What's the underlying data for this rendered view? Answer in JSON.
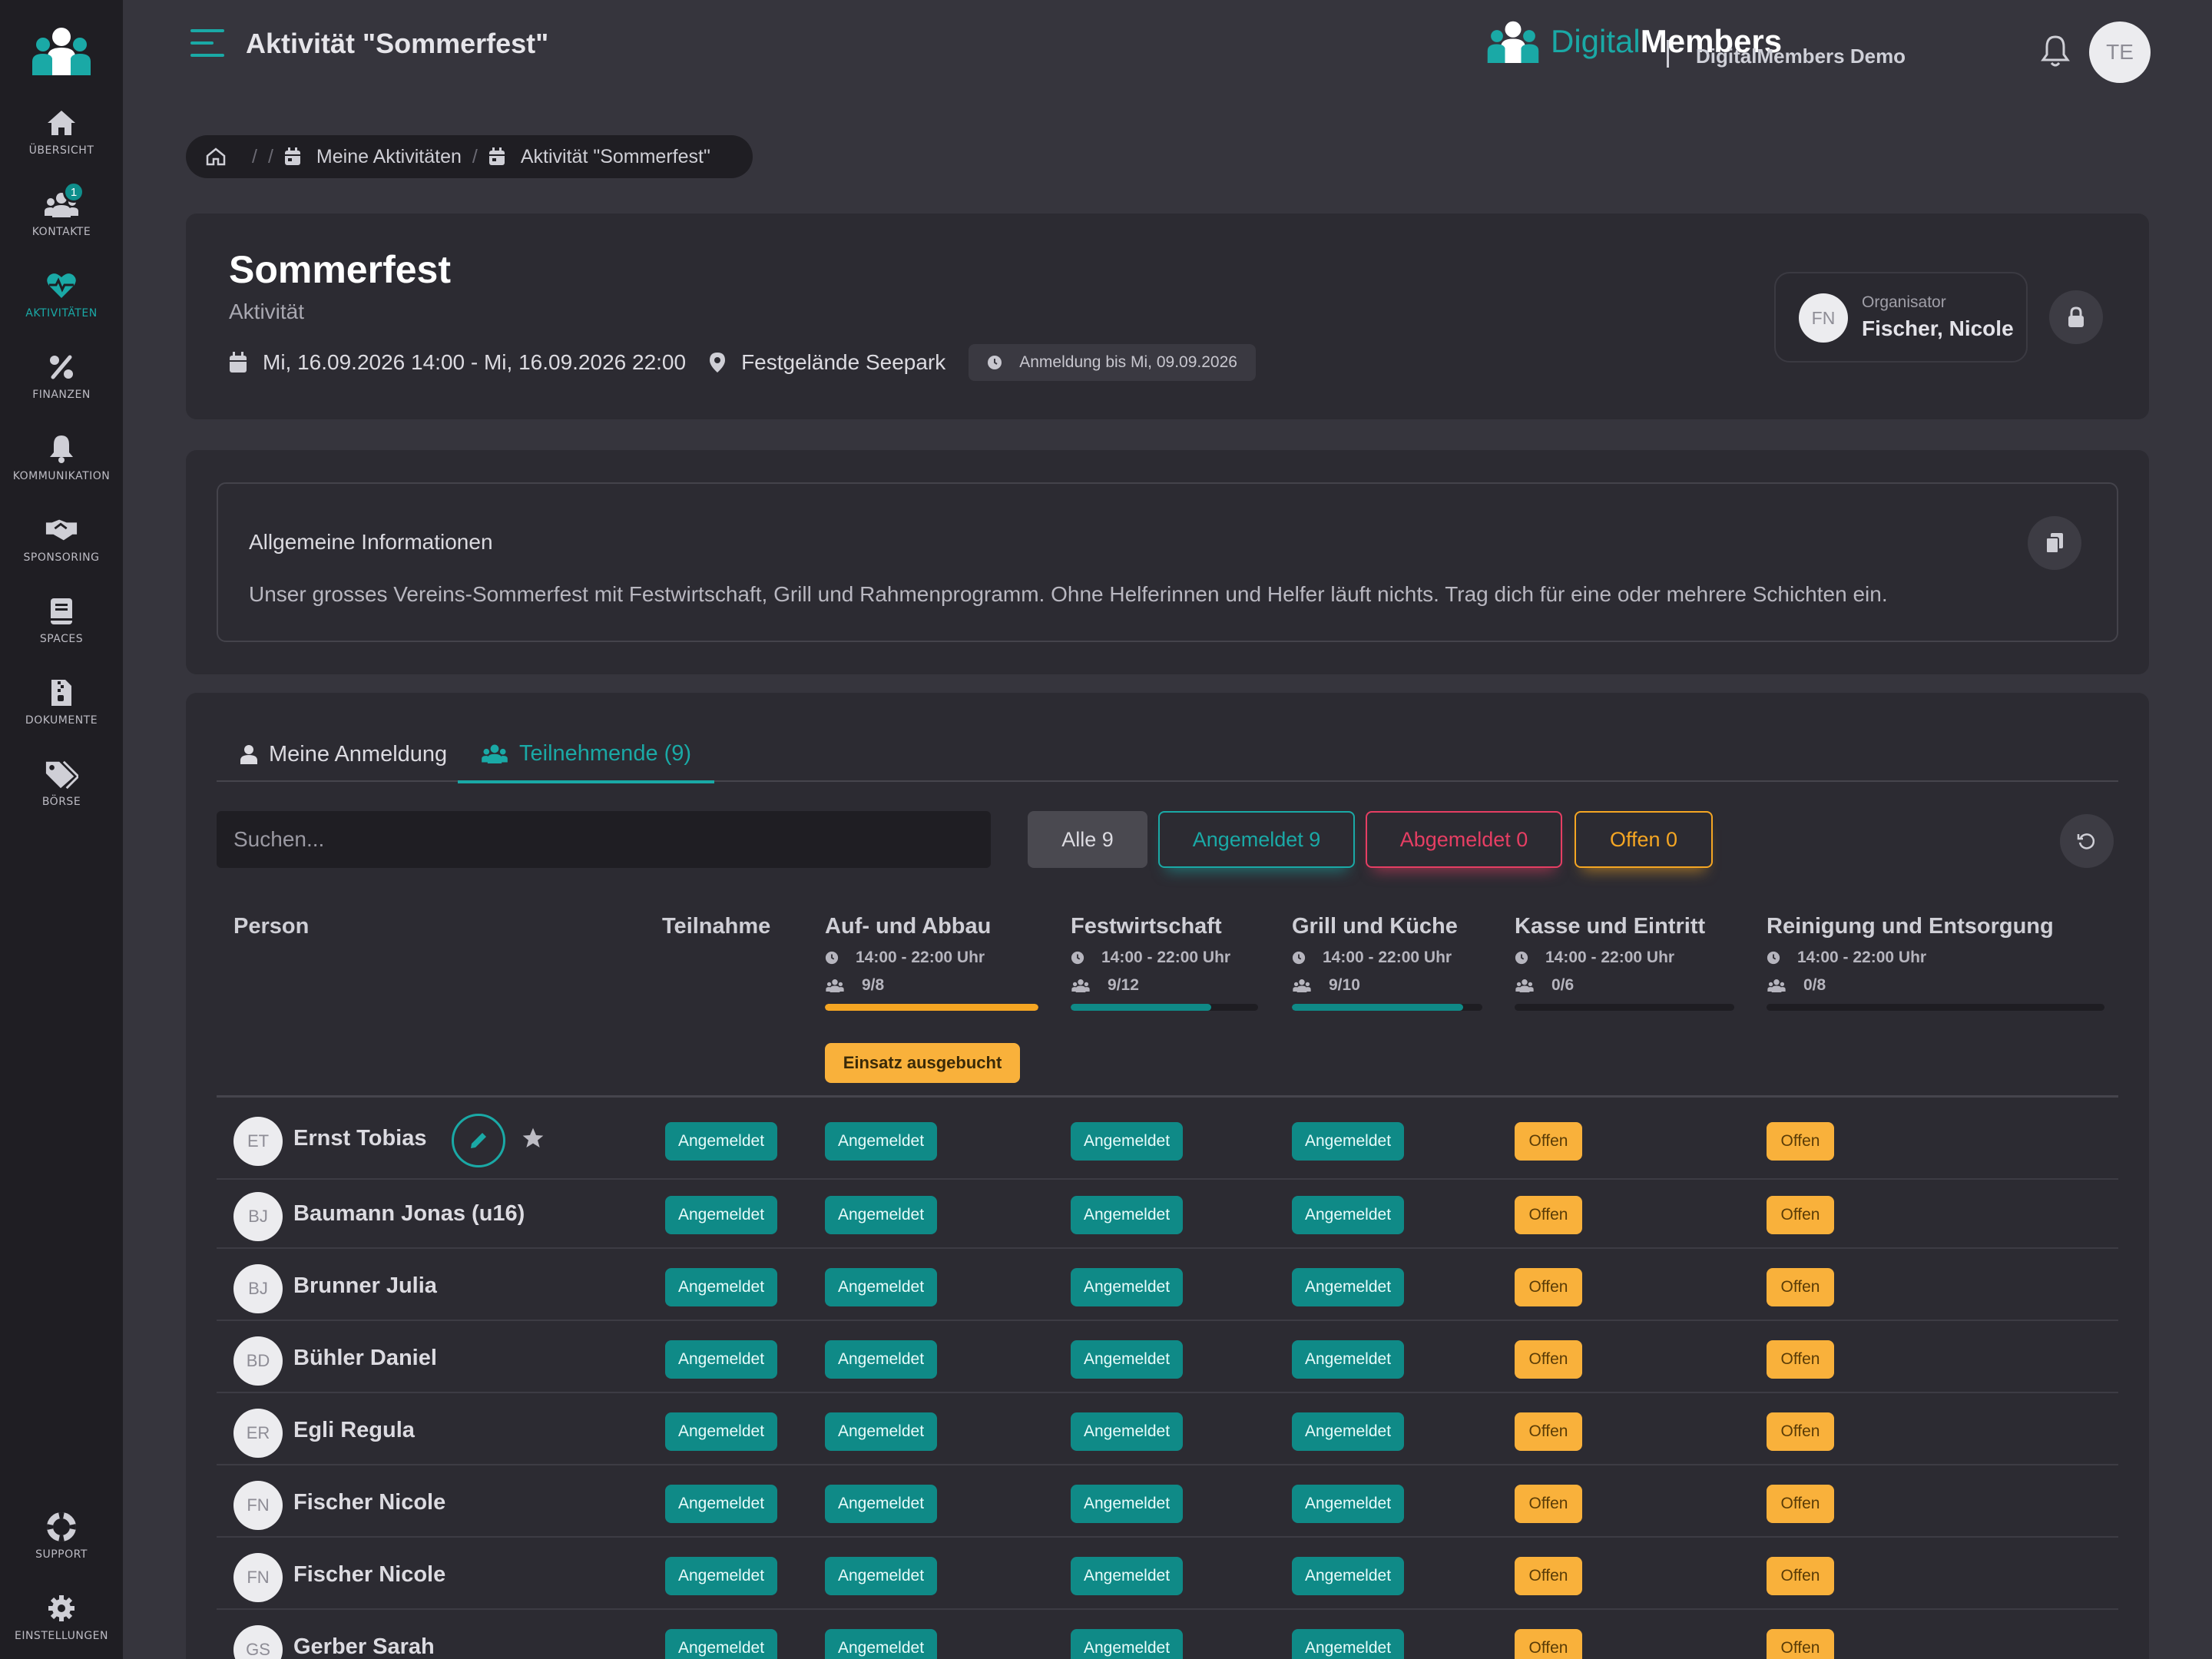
{
  "sidebar": {
    "items": [
      {
        "label": "ÜBERSICHT",
        "icon": "home-icon"
      },
      {
        "label": "KONTAKTE",
        "icon": "users-icon",
        "badge": "1"
      },
      {
        "label": "AKTIVITÄTEN",
        "icon": "heartbeat-icon",
        "active": true
      },
      {
        "label": "FINANZEN",
        "icon": "percent-icon"
      },
      {
        "label": "KOMMUNIKATION",
        "icon": "bell-icon"
      },
      {
        "label": "SPONSORING",
        "icon": "handshake-icon"
      },
      {
        "label": "SPACES",
        "icon": "book-icon"
      },
      {
        "label": "DOKUMENTE",
        "icon": "file-zipper-icon"
      },
      {
        "label": "BÖRSE",
        "icon": "tags-icon"
      }
    ],
    "bottom": [
      {
        "label": "SUPPORT",
        "icon": "lifering-icon"
      },
      {
        "label": "EINSTELLUNGEN",
        "icon": "gear-icon"
      }
    ]
  },
  "header": {
    "title": "Aktivität \"Sommerfest\"",
    "brand_part1": "Digital",
    "brand_part2": "Members",
    "org_name": "DigitalMembers Demo",
    "user_initials": "TE"
  },
  "breadcrumb": {
    "items": [
      "Meine Aktivitäten",
      "Aktivität \"Sommerfest\""
    ]
  },
  "event": {
    "title": "Sommerfest",
    "subtitle": "Aktivität",
    "datetime": "Mi, 16.09.2026 14:00 - Mi, 16.09.2026 22:00",
    "location": "Festgelände Seepark",
    "deadline": "Anmeldung bis Mi, 09.09.2026",
    "organizer_label": "Organisator",
    "organizer_name": "Fischer, Nicole",
    "organizer_initials": "FN"
  },
  "info": {
    "heading": "Allgemeine Informationen",
    "text": "Unser grosses Vereins-Sommerfest mit Festwirtschaft, Grill und Rahmenprogramm. Ohne Helferinnen und Helfer läuft nichts. Trag dich für eine oder mehrere Schichten ein."
  },
  "tabs": {
    "my_registration": "Meine Anmeldung",
    "participants": "Teilnehmende (9)"
  },
  "filters": {
    "search_placeholder": "Suchen...",
    "all": "Alle 9",
    "registered": "Angemeldet 9",
    "deregistered": "Abgemeldet 0",
    "open": "Offen 0"
  },
  "table": {
    "col_person": "Person",
    "col_participation": "Teilnahme",
    "shifts": [
      {
        "name": "Auf- und Abbau",
        "time": "14:00 - 22:00 Uhr",
        "count": "9/8",
        "fill": 1.0,
        "color": "#f5a623"
      },
      {
        "name": "Festwirtschaft",
        "time": "14:00 - 22:00 Uhr",
        "count": "9/12",
        "fill": 0.75,
        "color": "#0f8a87"
      },
      {
        "name": "Grill und Küche",
        "time": "14:00 - 22:00 Uhr",
        "count": "9/10",
        "fill": 0.9,
        "color": "#0f8a87"
      },
      {
        "name": "Kasse und Eintritt",
        "time": "14:00 - 22:00 Uhr",
        "count": "0/6",
        "fill": 0.0,
        "color": "#0f8a87"
      },
      {
        "name": "Reinigung und Entsorgung",
        "time": "14:00 - 22:00 Uhr",
        "count": "0/8",
        "fill": 0.0,
        "color": "#0f8a87"
      }
    ],
    "full_badge": "Einsatz ausgebucht",
    "status_registered": "Angemeldet",
    "status_open": "Offen",
    "rows": [
      {
        "initials": "ET",
        "name": "Ernst Tobias"
      },
      {
        "initials": "BJ",
        "name": "Baumann Jonas (u16)"
      },
      {
        "initials": "BJ",
        "name": "Brunner Julia"
      },
      {
        "initials": "BD",
        "name": "Bühler Daniel"
      },
      {
        "initials": "ER",
        "name": "Egli Regula"
      },
      {
        "initials": "FN",
        "name": "Fischer Nicole"
      },
      {
        "initials": "FN",
        "name": "Fischer Nicole"
      },
      {
        "initials": "GS",
        "name": "Gerber Sarah"
      }
    ]
  },
  "colors": {
    "accent": "#1aa9a6",
    "registered": "#0f8a87",
    "open": "#f9b13b",
    "deregistered": "#e63e63"
  }
}
